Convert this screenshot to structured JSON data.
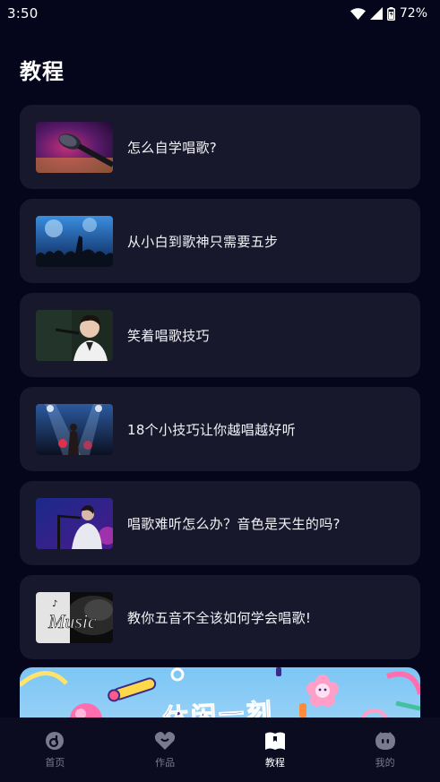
{
  "status_bar": {
    "time": "3:50",
    "battery": "72%",
    "icons": [
      "wifi-icon",
      "signal-icon",
      "battery-icon"
    ]
  },
  "page": {
    "title": "教程"
  },
  "tutorials": [
    {
      "title": "怎么自学唱歌?",
      "thumb": "microphone-image"
    },
    {
      "title": "从小白到歌神只需要五步",
      "thumb": "concert-crowd-image"
    },
    {
      "title": "笑着唱歌技巧",
      "thumb": "singer-smiling-image"
    },
    {
      "title": "18个小技巧让你越唱越好听",
      "thumb": "stage-performer-image"
    },
    {
      "title": "唱歌难听怎么办？音色是天生的吗?",
      "thumb": "singer-blue-light-image"
    },
    {
      "title": "教你五音不全该如何学会唱歌!",
      "thumb": "music-text-image"
    }
  ],
  "banner": {
    "text": "休闲一刻",
    "thumb_text": "Music"
  },
  "bottom_nav": {
    "items": [
      {
        "label": "首页",
        "icon": "home-disc-icon",
        "active": false
      },
      {
        "label": "作品",
        "icon": "heart-icon",
        "active": false
      },
      {
        "label": "教程",
        "icon": "book-icon",
        "active": true
      },
      {
        "label": "我的",
        "icon": "profile-face-icon",
        "active": false
      }
    ]
  },
  "colors": {
    "background": "#05051c",
    "card": "#18182d",
    "nav_inactive": "#7a7a8e",
    "nav_active": "#ffffff"
  }
}
